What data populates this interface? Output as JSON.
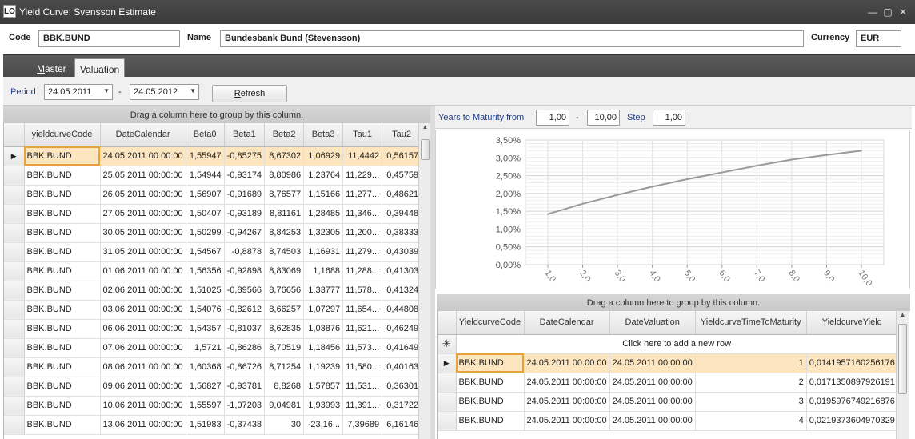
{
  "window": {
    "title": "Yield Curve: Svensson Estimate",
    "icon_text": "LO",
    "controls": [
      "minimize-icon",
      "maximize-icon",
      "close-icon"
    ]
  },
  "header": {
    "code_label": "Code",
    "code_value": "BBK.BUND",
    "name_label": "Name",
    "name_value": "Bundesbank Bund (Stevensson)",
    "currency_label": "Currency",
    "currency_value": "EUR"
  },
  "tabs": [
    {
      "label": "Master",
      "active": false
    },
    {
      "label": "Valuation",
      "active": true
    }
  ],
  "period": {
    "label": "Period",
    "from": "24.05.2011",
    "separator": "-",
    "to": "24.05.2012",
    "refresh_label": "Refresh"
  },
  "left_grid": {
    "group_hint": "Drag a column here to group by this column.",
    "columns": [
      "yieldcurveCode",
      "DateCalendar",
      "Beta0",
      "Beta1",
      "Beta2",
      "Beta3",
      "Tau1",
      "Tau2"
    ],
    "rows": [
      [
        "BBK.BUND",
        "24.05.2011 00:00:00",
        "1,55947",
        "-0,85275",
        "8,67302",
        "1,06929",
        "11,4442",
        "0,56157"
      ],
      [
        "BBK.BUND",
        "25.05.2011 00:00:00",
        "1,54944",
        "-0,93174",
        "8,80986",
        "1,23764",
        "11,229...",
        "0,45759"
      ],
      [
        "BBK.BUND",
        "26.05.2011 00:00:00",
        "1,56907",
        "-0,91689",
        "8,76577",
        "1,15166",
        "11,277...",
        "0,48621"
      ],
      [
        "BBK.BUND",
        "27.05.2011 00:00:00",
        "1,50407",
        "-0,93189",
        "8,81161",
        "1,28485",
        "11,346...",
        "0,39448"
      ],
      [
        "BBK.BUND",
        "30.05.2011 00:00:00",
        "1,50299",
        "-0,94267",
        "8,84253",
        "1,32305",
        "11,200...",
        "0,38333"
      ],
      [
        "BBK.BUND",
        "31.05.2011 00:00:00",
        "1,54567",
        "-0,8878",
        "8,74503",
        "1,16931",
        "11,279...",
        "0,43039"
      ],
      [
        "BBK.BUND",
        "01.06.2011 00:00:00",
        "1,56356",
        "-0,92898",
        "8,83069",
        "1,1688",
        "11,288...",
        "0,41303"
      ],
      [
        "BBK.BUND",
        "02.06.2011 00:00:00",
        "1,51025",
        "-0,89566",
        "8,76656",
        "1,33777",
        "11,578...",
        "0,41324"
      ],
      [
        "BBK.BUND",
        "03.06.2011 00:00:00",
        "1,54076",
        "-0,82612",
        "8,66257",
        "1,07297",
        "11,654...",
        "0,44808"
      ],
      [
        "BBK.BUND",
        "06.06.2011 00:00:00",
        "1,54357",
        "-0,81037",
        "8,62835",
        "1,03876",
        "11,621...",
        "0,46249"
      ],
      [
        "BBK.BUND",
        "07.06.2011 00:00:00",
        "1,5721",
        "-0,86286",
        "8,70519",
        "1,18456",
        "11,573...",
        "0,41649"
      ],
      [
        "BBK.BUND",
        "08.06.2011 00:00:00",
        "1,60368",
        "-0,86726",
        "8,71254",
        "1,19239",
        "11,580...",
        "0,40163"
      ],
      [
        "BBK.BUND",
        "09.06.2011 00:00:00",
        "1,56827",
        "-0,93781",
        "8,8268",
        "1,57857",
        "11,531...",
        "0,36301"
      ],
      [
        "BBK.BUND",
        "10.06.2011 00:00:00",
        "1,55597",
        "-1,07203",
        "9,04981",
        "1,93993",
        "11,391...",
        "0,31722"
      ],
      [
        "BBK.BUND",
        "13.06.2011 00:00:00",
        "1,51983",
        "-0,37438",
        "30",
        "-23,16...",
        "7,39689",
        "6,16146"
      ]
    ]
  },
  "maturity": {
    "from_label": "Years to Maturity from",
    "from_value": "1,00",
    "separator": "-",
    "to_value": "10,00",
    "step_label": "Step",
    "step_value": "1,00"
  },
  "chart_data": {
    "type": "line",
    "x": [
      1,
      2,
      3,
      4,
      5,
      6,
      7,
      8,
      9,
      10
    ],
    "x_tick_labels": [
      "1,0",
      "2,0",
      "3,0",
      "4,0",
      "5,0",
      "6,0",
      "7,0",
      "8,0",
      "9,0",
      "10,0"
    ],
    "series": [
      {
        "values": [
          1.42,
          1.71,
          1.96,
          2.19,
          2.4,
          2.59,
          2.78,
          2.95,
          3.08,
          3.2
        ]
      }
    ],
    "ylim": [
      0,
      3.5
    ],
    "y_tick_labels": [
      "0,00%",
      "0,50%",
      "1,00%",
      "1,50%",
      "2,00%",
      "2,50%",
      "3,00%",
      "3,50%"
    ],
    "grid": true,
    "color": "#9a9a9a"
  },
  "right_grid": {
    "group_hint": "Drag a column here to group by this column.",
    "columns": [
      "YieldcurveCode",
      "DateCalendar",
      "DateValuation",
      "YieldcurveTimeToMaturity",
      "YieldcurveYield"
    ],
    "new_row_hint": "Click here to add a new row",
    "rows": [
      [
        "BBK.BUND",
        "24.05.2011 00:00:00",
        "24.05.2011 00:00:00",
        "1",
        "0,0141957160256176"
      ],
      [
        "BBK.BUND",
        "24.05.2011 00:00:00",
        "24.05.2011 00:00:00",
        "2",
        "0,0171350897926191"
      ],
      [
        "BBK.BUND",
        "24.05.2011 00:00:00",
        "24.05.2011 00:00:00",
        "3",
        "0,0195976749216876"
      ],
      [
        "BBK.BUND",
        "24.05.2011 00:00:00",
        "24.05.2011 00:00:00",
        "4",
        "0,0219373604970329"
      ]
    ]
  }
}
